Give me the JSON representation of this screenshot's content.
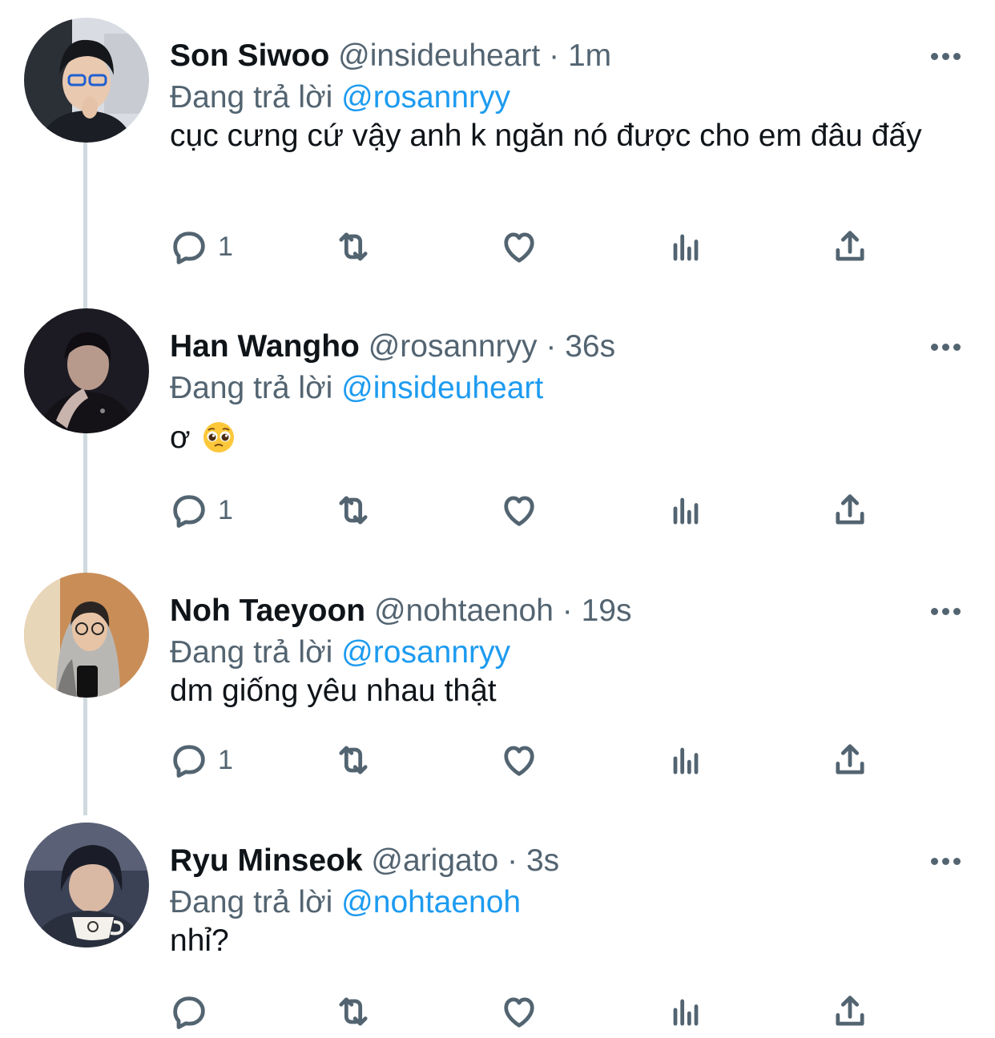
{
  "colors": {
    "accent": "#1d9bf0",
    "secondary_text": "#536471",
    "primary_text": "#0f1419",
    "thread_line": "#cfd9de"
  },
  "reply_prefix": "Đang trả lời",
  "separator": "·",
  "tweets": [
    {
      "name": "Son Siwoo",
      "handle": "@insideuheart",
      "time": "1m",
      "reply_to": "@rosannryy",
      "text": "cục cưng cứ vậy anh k ngăn nó được cho em đâu đấy",
      "reply_count": "1",
      "avatar_icon": "profile-photo"
    },
    {
      "name": "Han Wangho",
      "handle": "@rosannryy",
      "time": "36s",
      "reply_to": "@insideuheart",
      "text": "ơ",
      "emoji": "pleading-face-emoji",
      "reply_count": "1",
      "avatar_icon": "profile-photo"
    },
    {
      "name": "Noh Taeyoon",
      "handle": "@nohtaenoh",
      "time": "19s",
      "reply_to": "@rosannryy",
      "text": "dm giống yêu nhau thật",
      "reply_count": "1",
      "avatar_icon": "profile-photo"
    },
    {
      "name": "Ryu Minseok",
      "handle": "@arigato",
      "time": "3s",
      "reply_to": "@nohtaenoh",
      "text": "nhỉ?",
      "reply_count": "",
      "avatar_icon": "profile-photo"
    }
  ],
  "action_icons": [
    "reply-icon",
    "retweet-icon",
    "like-icon",
    "analytics-icon",
    "share-icon"
  ]
}
